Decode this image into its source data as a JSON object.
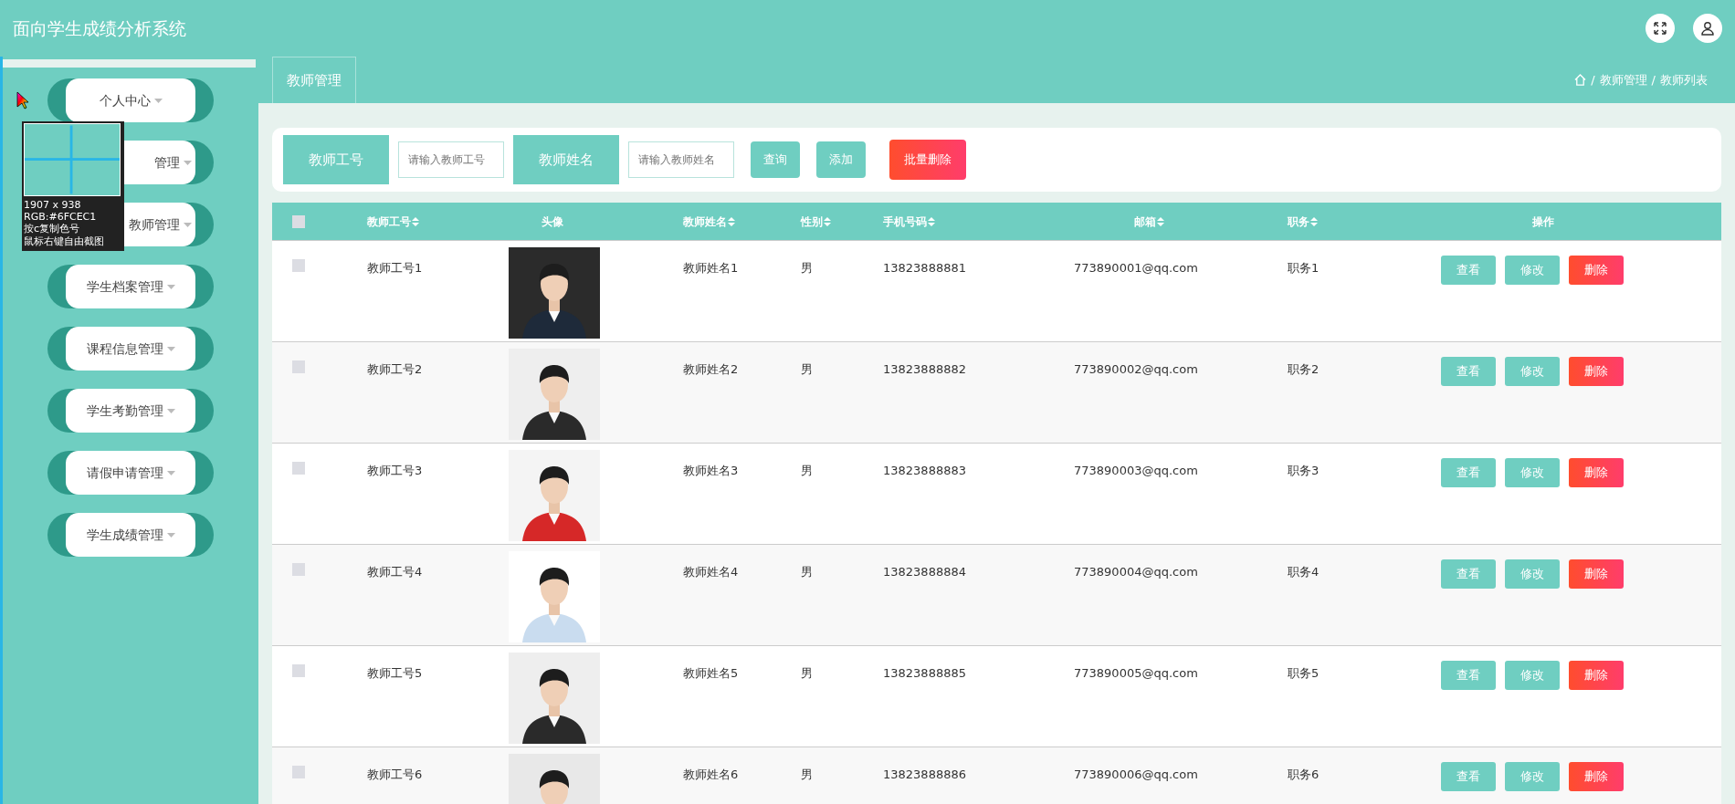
{
  "app_title": "面向学生成绩分析系统",
  "sidebar": {
    "items": [
      {
        "label": "个人中心"
      },
      {
        "label": "管理"
      },
      {
        "label": "教师管理"
      },
      {
        "label": "学生档案管理"
      },
      {
        "label": "课程信息管理"
      },
      {
        "label": "学生考勤管理"
      },
      {
        "label": "请假申请管理"
      },
      {
        "label": "学生成绩管理"
      }
    ]
  },
  "color_picker": {
    "size": "1907 x 938",
    "rgb": "RGB:#6FCEC1",
    "hint_copy": "按c复制色号",
    "hint_capture": "鼠标右键自由截图"
  },
  "page_tab": "教师管理",
  "breadcrumb_separator": "/",
  "breadcrumb": [
    "教师管理",
    "教师列表"
  ],
  "search": {
    "fields": [
      {
        "label": "教师工号",
        "placeholder": "请输入教师工号"
      },
      {
        "label": "教师姓名",
        "placeholder": "请输入教师姓名"
      }
    ],
    "buttons": [
      {
        "label": "查询",
        "kind": "primary"
      },
      {
        "label": "添加",
        "kind": "primary"
      },
      {
        "label": "批量删除",
        "kind": "danger"
      }
    ]
  },
  "table": {
    "select_all": {
      "checked": false
    },
    "columns": [
      {
        "label": "教师工号",
        "sortable": true
      },
      {
        "label": "头像",
        "sortable": false
      },
      {
        "label": "教师姓名",
        "sortable": true
      },
      {
        "label": "性别",
        "sortable": true
      },
      {
        "label": "手机号码",
        "sortable": true
      },
      {
        "label": "邮箱",
        "sortable": true
      },
      {
        "label": "职务",
        "sortable": true
      },
      {
        "label": "操作",
        "sortable": false
      }
    ],
    "rows": [
      {
        "checked": false,
        "teacher_id": "教师工号1",
        "teacher_name": "教师姓名1",
        "gender": "男",
        "phone": "13823888881",
        "email": "773890001@qq.com",
        "position": "职务1",
        "actions": [
          {
            "label": "查看",
            "kind": "primary"
          },
          {
            "label": "修改",
            "kind": "primary"
          },
          {
            "label": "删除",
            "kind": "danger"
          }
        ]
      },
      {
        "checked": false,
        "teacher_id": "教师工号2",
        "teacher_name": "教师姓名2",
        "gender": "男",
        "phone": "13823888882",
        "email": "773890002@qq.com",
        "position": "职务2",
        "actions": [
          {
            "label": "查看",
            "kind": "primary"
          },
          {
            "label": "修改",
            "kind": "primary"
          },
          {
            "label": "删除",
            "kind": "danger"
          }
        ]
      },
      {
        "checked": false,
        "teacher_id": "教师工号3",
        "teacher_name": "教师姓名3",
        "gender": "男",
        "phone": "13823888883",
        "email": "773890003@qq.com",
        "position": "职务3",
        "actions": [
          {
            "label": "查看",
            "kind": "primary"
          },
          {
            "label": "修改",
            "kind": "primary"
          },
          {
            "label": "删除",
            "kind": "danger"
          }
        ]
      },
      {
        "checked": false,
        "teacher_id": "教师工号4",
        "teacher_name": "教师姓名4",
        "gender": "男",
        "phone": "13823888884",
        "email": "773890004@qq.com",
        "position": "职务4",
        "actions": [
          {
            "label": "查看",
            "kind": "primary"
          },
          {
            "label": "修改",
            "kind": "primary"
          },
          {
            "label": "删除",
            "kind": "danger"
          }
        ]
      },
      {
        "checked": false,
        "teacher_id": "教师工号5",
        "teacher_name": "教师姓名5",
        "gender": "男",
        "phone": "13823888885",
        "email": "773890005@qq.com",
        "position": "职务5",
        "actions": [
          {
            "label": "查看",
            "kind": "primary"
          },
          {
            "label": "修改",
            "kind": "primary"
          },
          {
            "label": "删除",
            "kind": "danger"
          }
        ]
      },
      {
        "checked": false,
        "teacher_id": "教师工号6",
        "teacher_name": "教师姓名6",
        "gender": "男",
        "phone": "13823888886",
        "email": "773890006@qq.com",
        "position": "职务6",
        "actions": [
          {
            "label": "查看",
            "kind": "primary"
          },
          {
            "label": "修改",
            "kind": "primary"
          },
          {
            "label": "删除",
            "kind": "danger"
          }
        ]
      }
    ]
  }
}
